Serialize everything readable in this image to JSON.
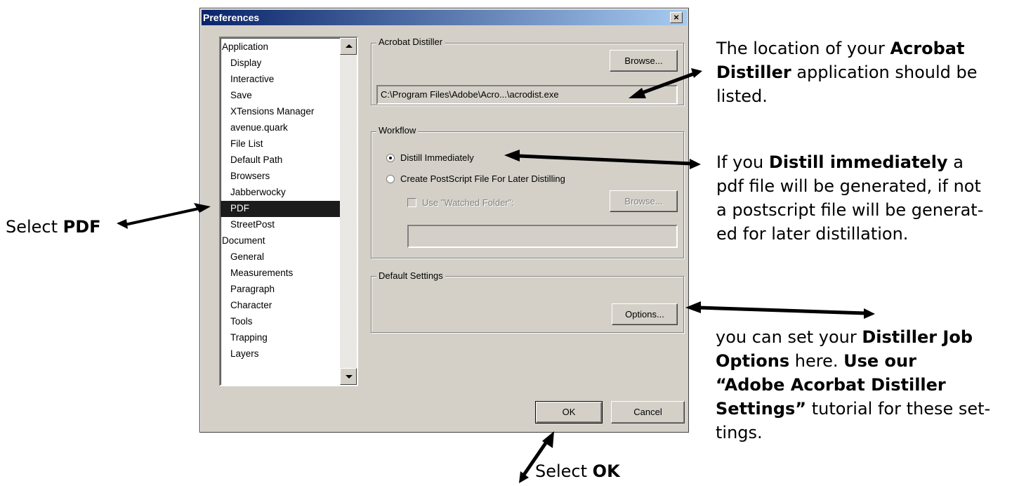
{
  "dialog": {
    "title": "Preferences",
    "close_label": "×"
  },
  "list": {
    "items": [
      {
        "label": "Application",
        "level": 0
      },
      {
        "label": "Display",
        "level": 1
      },
      {
        "label": "Interactive",
        "level": 1
      },
      {
        "label": "Save",
        "level": 1
      },
      {
        "label": "XTensions Manager",
        "level": 1
      },
      {
        "label": "avenue.quark",
        "level": 1
      },
      {
        "label": "File List",
        "level": 1
      },
      {
        "label": "Default Path",
        "level": 1
      },
      {
        "label": "Browsers",
        "level": 1
      },
      {
        "label": "Jabberwocky",
        "level": 1
      },
      {
        "label": "PDF",
        "level": 1,
        "selected": true
      },
      {
        "label": "StreetPost",
        "level": 1
      },
      {
        "label": "Document",
        "level": 0
      },
      {
        "label": "General",
        "level": 1
      },
      {
        "label": "Measurements",
        "level": 1
      },
      {
        "label": "Paragraph",
        "level": 1
      },
      {
        "label": "Character",
        "level": 1
      },
      {
        "label": "Tools",
        "level": 1
      },
      {
        "label": "Trapping",
        "level": 1
      },
      {
        "label": "Layers",
        "level": 1
      }
    ]
  },
  "distiller_group": {
    "label": "Acrobat Distiller",
    "browse_label": "Browse...",
    "path_value": "C:\\Program Files\\Adobe\\Acro...\\acrodist.exe"
  },
  "workflow_group": {
    "label": "Workflow",
    "option_immediate": "Distill Immediately",
    "option_later": "Create PostScript File For Later Distilling",
    "watched_folder_label": "Use \"Watched Folder\":",
    "browse_label": "Browse...",
    "folder_value": ""
  },
  "defaults_group": {
    "label": "Default Settings",
    "options_label": "Options..."
  },
  "footer": {
    "ok_label": "OK",
    "cancel_label": "Cancel"
  },
  "annotations": {
    "select_pdf_pre": "Select ",
    "select_pdf_bold": "PDF",
    "select_ok_pre": "Select ",
    "select_ok_bold": "OK",
    "distiller_line1_pre": "The location of your ",
    "distiller_line1_bold": "Acrobat",
    "distiller_line2_bold": "Distiller",
    "distiller_line2_post": " application should be",
    "distiller_line3": "listed.",
    "distill_line1_pre": "If you ",
    "distill_line1_bold": "Distill immediately",
    "distill_line1_post": " a",
    "distill_line2": "pdf file will be generated, if not",
    "distill_line3": "a postscript file will be generat-",
    "distill_line4": "ed for later distillation.",
    "options_line1_pre": "you can set your ",
    "options_line1_bold": "Distiller Job",
    "options_line2_bold": "Options",
    "options_line2_mid": " here. ",
    "options_line2_bold2": "Use our",
    "options_line3_bold": "“Adobe Acorbat Distiller",
    "options_line4_bold": "Settings”",
    "options_line4_post": " tutorial for these set-",
    "options_line5": "tings."
  }
}
